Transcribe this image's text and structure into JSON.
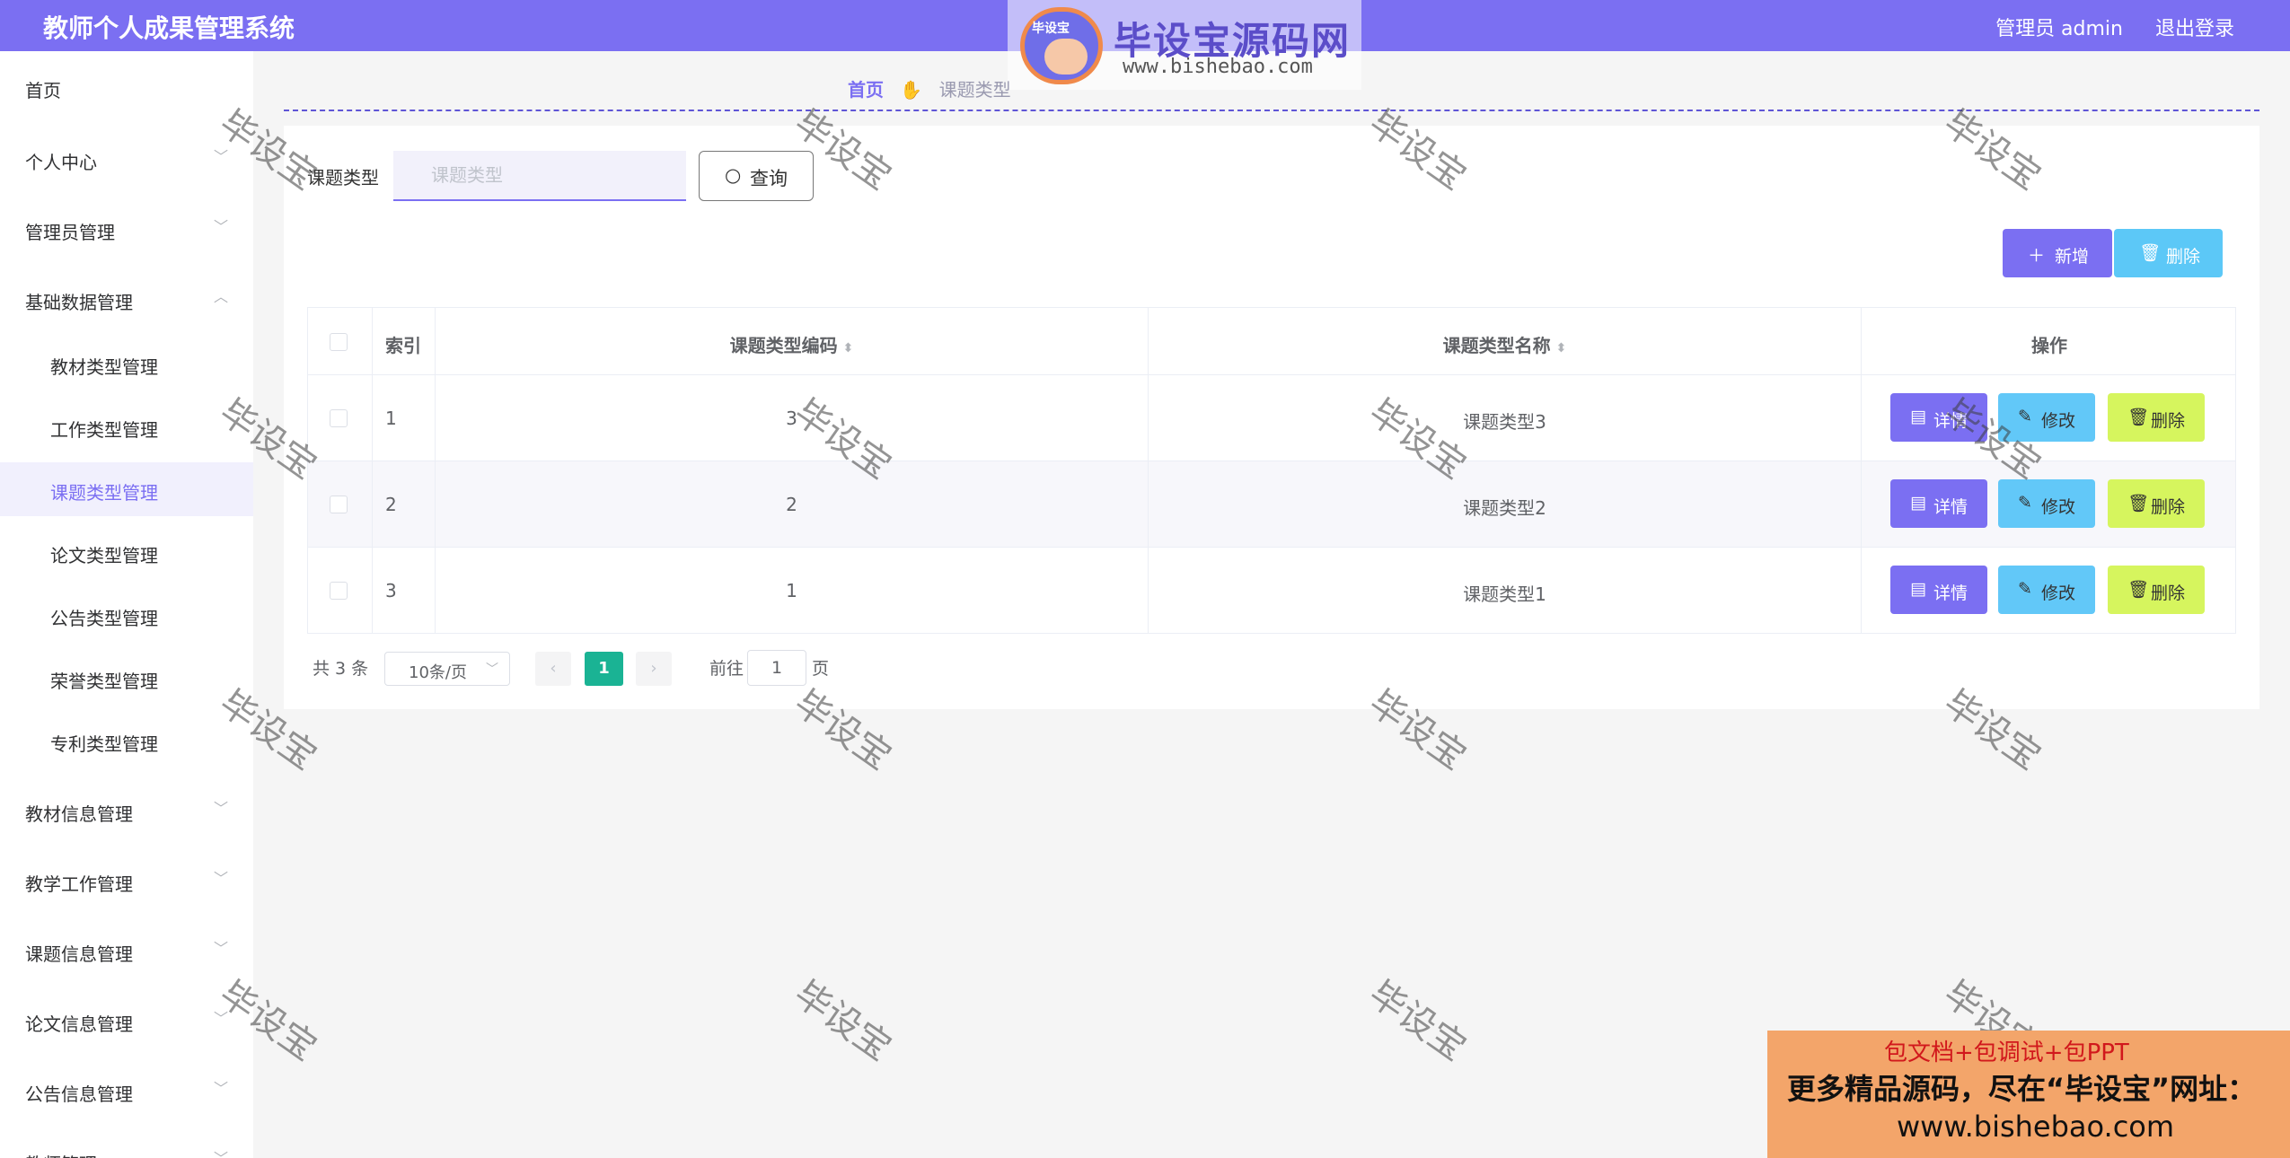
{
  "header": {
    "title": "教师个人成果管理系统",
    "user": "管理员 admin",
    "logout": "退出登录"
  },
  "logo": {
    "mascot_text": "毕设宝",
    "brand": "毕设宝源码网",
    "url": "www.bishebao.com"
  },
  "sidebar": {
    "items": [
      {
        "label": "首页"
      },
      {
        "label": "个人中心"
      },
      {
        "label": "管理员管理"
      },
      {
        "label": "基础数据管理"
      },
      {
        "label": "教材类型管理"
      },
      {
        "label": "工作类型管理"
      },
      {
        "label": "课题类型管理"
      },
      {
        "label": "论文类型管理"
      },
      {
        "label": "公告类型管理"
      },
      {
        "label": "荣誉类型管理"
      },
      {
        "label": "专利类型管理"
      },
      {
        "label": "教材信息管理"
      },
      {
        "label": "教学工作管理"
      },
      {
        "label": "课题信息管理"
      },
      {
        "label": "论文信息管理"
      },
      {
        "label": "公告信息管理"
      },
      {
        "label": "教师管理"
      }
    ]
  },
  "breadcrumb": {
    "home": "首页",
    "sep": "✋",
    "current": "课题类型"
  },
  "search": {
    "label": "课题类型",
    "placeholder": "课题类型",
    "value": "",
    "button": "查询"
  },
  "actions": {
    "add": "新增",
    "delete": "删除"
  },
  "table": {
    "headers": {
      "index": "索引",
      "code": "课题类型编码",
      "name": "课题类型名称",
      "ops": "操作"
    },
    "rows": [
      {
        "index": "1",
        "code": "3",
        "name": "课题类型3"
      },
      {
        "index": "2",
        "code": "2",
        "name": "课题类型2"
      },
      {
        "index": "3",
        "code": "1",
        "name": "课题类型1"
      }
    ],
    "row_buttons": {
      "detail": "详情",
      "edit": "修改",
      "delete": "删除"
    }
  },
  "pagination": {
    "total": "共 3 条",
    "page_size": "10条/页",
    "current_page": "1",
    "goto_label": "前往",
    "goto_value": "1",
    "goto_unit": "页"
  },
  "watermark": {
    "text": "毕设宝"
  },
  "ad": {
    "line1": "包文档+包调试+包PPT",
    "line2": "更多精品源码，尽在“毕设宝”网址：",
    "line3": "www.bishebao.com"
  },
  "colors": {
    "primary": "#7b6ff2",
    "info": "#5cc8f7",
    "warn": "#d6f55e",
    "page_active": "#1ab394"
  }
}
